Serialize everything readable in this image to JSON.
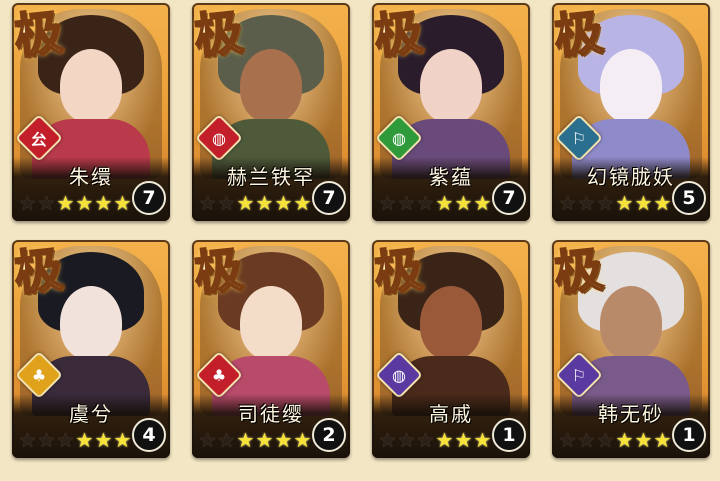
{
  "cards": [
    {
      "badge": "㕕",
      "badge_color": "#c21f2a",
      "name": "朱缳",
      "count": "7",
      "stars_dark": 2,
      "stars_gold": 4,
      "hair": "#3a2418",
      "skin": "#f3d6c4",
      "cloth": "#b93a4a"
    },
    {
      "badge": "◍",
      "badge_color": "#c21f2a",
      "name": "赫兰铁罕",
      "count": "7",
      "stars_dark": 2,
      "stars_gold": 4,
      "hair": "#5b5e4a",
      "skin": "#a8704c",
      "cloth": "#4e5a3a"
    },
    {
      "badge": "◍",
      "badge_color": "#2f9a3a",
      "name": "紫蕴",
      "count": "7",
      "stars_dark": 3,
      "stars_gold": 3,
      "hair": "#2a1c2a",
      "skin": "#f1d2c6",
      "cloth": "#6a4a7a"
    },
    {
      "badge": "⚐",
      "badge_color": "#2a6f8e",
      "name": "幻镜胧妖",
      "count": "5",
      "stars_dark": 3,
      "stars_gold": 3,
      "hair": "#b9b4e6",
      "skin": "#f4eef4",
      "cloth": "#8f8ac9"
    },
    {
      "badge": "♣",
      "badge_color": "#e0a21a",
      "name": "虞兮",
      "count": "4",
      "stars_dark": 3,
      "stars_gold": 3,
      "hair": "#1a1a22",
      "skin": "#f2e2dc",
      "cloth": "#3a2a3a"
    },
    {
      "badge": "♣",
      "badge_color": "#c21f2a",
      "name": "司徒缨",
      "count": "2",
      "stars_dark": 2,
      "stars_gold": 4,
      "hair": "#6a3a22",
      "skin": "#f3dcc8",
      "cloth": "#b84a6a"
    },
    {
      "badge": "◍",
      "badge_color": "#5a3aa0",
      "name": "高戚",
      "count": "1",
      "stars_dark": 3,
      "stars_gold": 3,
      "hair": "#3a2418",
      "skin": "#9a5a3a",
      "cloth": "#4a2a1a"
    },
    {
      "badge": "⚐",
      "badge_color": "#5a3aa0",
      "name": "韩无砂",
      "count": "1",
      "stars_dark": 3,
      "stars_gold": 3,
      "hair": "#e4e0e0",
      "skin": "#b98a6a",
      "cloth": "#7a5a8a"
    }
  ],
  "quality_mark": "极"
}
